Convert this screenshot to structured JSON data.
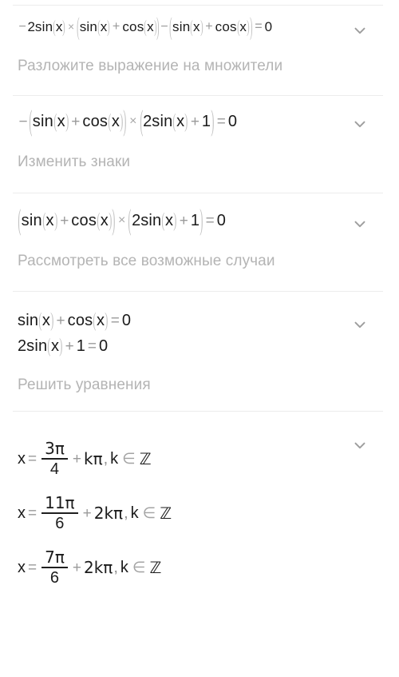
{
  "app": {
    "language": "ru",
    "background": "#ffffff",
    "text_color": "#1b1b1b",
    "hint_color": "#b4b4b4",
    "divider_color": "#ececec",
    "operator_color": "#9a9a9a",
    "paren_color": "#c3c3c3"
  },
  "icons": {
    "chevron": "chevron-down-icon"
  },
  "steps": [
    {
      "id": "step-1",
      "expression_text": "-2sin(x)×(sin(x)+cos(x))-(sin(x)+cos(x))=0",
      "hint": "Разложите выражение на множители",
      "tokens": {
        "minus": "−",
        "two": "2",
        "sin": "sin",
        "cos": "cos",
        "x": "x",
        "times": "×",
        "plus": "+",
        "equals": "=",
        "zero": "0",
        "lparen": "(",
        "rparen": ")"
      }
    },
    {
      "id": "step-2",
      "expression_text": "-(sin(x)+cos(x))×(2sin(x)+1)=0",
      "hint": "Изменить знаки",
      "tokens": {
        "minus": "−",
        "sin": "sin",
        "cos": "cos",
        "x": "x",
        "times": "×",
        "plus": "+",
        "two": "2",
        "one": "1",
        "equals": "=",
        "zero": "0",
        "lparen": "(",
        "rparen": ")"
      }
    },
    {
      "id": "step-3",
      "expression_text": "(sin(x)+cos(x))×(2sin(x)+1)=0",
      "hint": "Рассмотреть все возможные случаи",
      "tokens": {
        "sin": "sin",
        "cos": "cos",
        "x": "x",
        "times": "×",
        "plus": "+",
        "two": "2",
        "one": "1",
        "equals": "=",
        "zero": "0",
        "lparen": "(",
        "rparen": ")"
      }
    },
    {
      "id": "step-4",
      "expression_text_line1": "sin(x)+cos(x)=0",
      "expression_text_line2": "2sin(x)+1=0",
      "hint": "Решить уравнения",
      "tokens": {
        "sin": "sin",
        "cos": "cos",
        "x": "x",
        "plus": "+",
        "two": "2",
        "one": "1",
        "equals": "=",
        "zero": "0",
        "lparen": "(",
        "rparen": ")"
      }
    },
    {
      "id": "step-5",
      "hint": "",
      "solutions": [
        {
          "text": "x = 3π/4 + kπ, k ∈ ℤ",
          "lhs": "x",
          "equals": "=",
          "numerator": "3π",
          "denominator": "4",
          "plus": "+",
          "term": "kπ",
          "comma": ",",
          "k": "k",
          "in": "∈",
          "set": "ℤ"
        },
        {
          "text": "x = 11π/6 + 2kπ, k ∈ ℤ",
          "lhs": "x",
          "equals": "=",
          "numerator": "11π",
          "denominator": "6",
          "plus": "+",
          "term": "2kπ",
          "comma": ",",
          "k": "k",
          "in": "∈",
          "set": "ℤ"
        },
        {
          "text": "x = 7π/6 + 2kπ, k ∈ ℤ",
          "lhs": "x",
          "equals": "=",
          "numerator": "7π",
          "denominator": "6",
          "plus": "+",
          "term": "2kπ",
          "comma": ",",
          "k": "k",
          "in": "∈",
          "set": "ℤ"
        }
      ]
    }
  ]
}
